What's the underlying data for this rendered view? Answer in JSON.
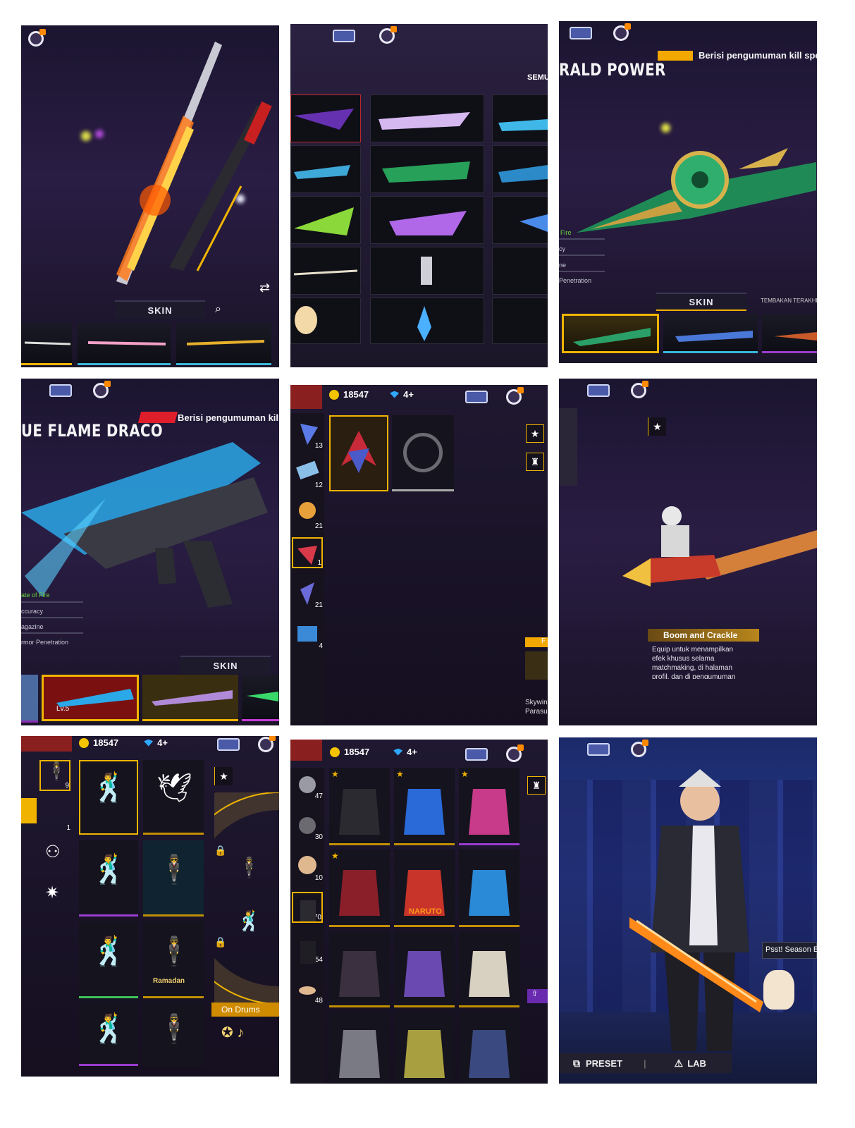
{
  "panel1": {
    "skin_tab": "SKIN"
  },
  "panel2": {
    "filter_label": "SEMU"
  },
  "panel3": {
    "announce": "Berisi pengumuman kill spe",
    "title": "RALD POWER",
    "stats": [
      "Fire",
      "cy",
      "ne",
      "Penetration"
    ],
    "skin_tab": "SKIN",
    "tab_other": "TEMBAKAN TERAKHI"
  },
  "panel4": {
    "announce": "Berisi pengumuman kill",
    "title": "UE FLAME DRACO",
    "stats": [
      "ate of Fire",
      "ccuracy",
      "agazine",
      "rmor Penetration"
    ],
    "skin_tab": "SKIN",
    "level": "Lv.5"
  },
  "panel5": {
    "coins": "18547",
    "gems": "4+",
    "counts": [
      "13",
      "12",
      "21",
      "1",
      "21",
      "4"
    ],
    "side_label_1": "F",
    "side_label_2": "Skywin",
    "side_label_3": "Parasu"
  },
  "panel6": {
    "item_title": "Boom and Crackle",
    "item_desc": "Equip untuk menampilkan efek khusus selama matchmaking, di halaman profil, dan di pengumuman"
  },
  "panel7": {
    "coins": "18547",
    "gems": "4+",
    "counts": [
      "9",
      "1"
    ],
    "emote_label": "On Drums",
    "ramadan": "Ramadan"
  },
  "panel8": {
    "coins": "18547",
    "gems": "4+",
    "counts": [
      "47",
      "30",
      "10",
      "70",
      "54",
      "48"
    ],
    "naruto": "NARUTO"
  },
  "panel9": {
    "hint": "Psst! Season E",
    "preset": "PRESET",
    "lab": "LAB"
  }
}
